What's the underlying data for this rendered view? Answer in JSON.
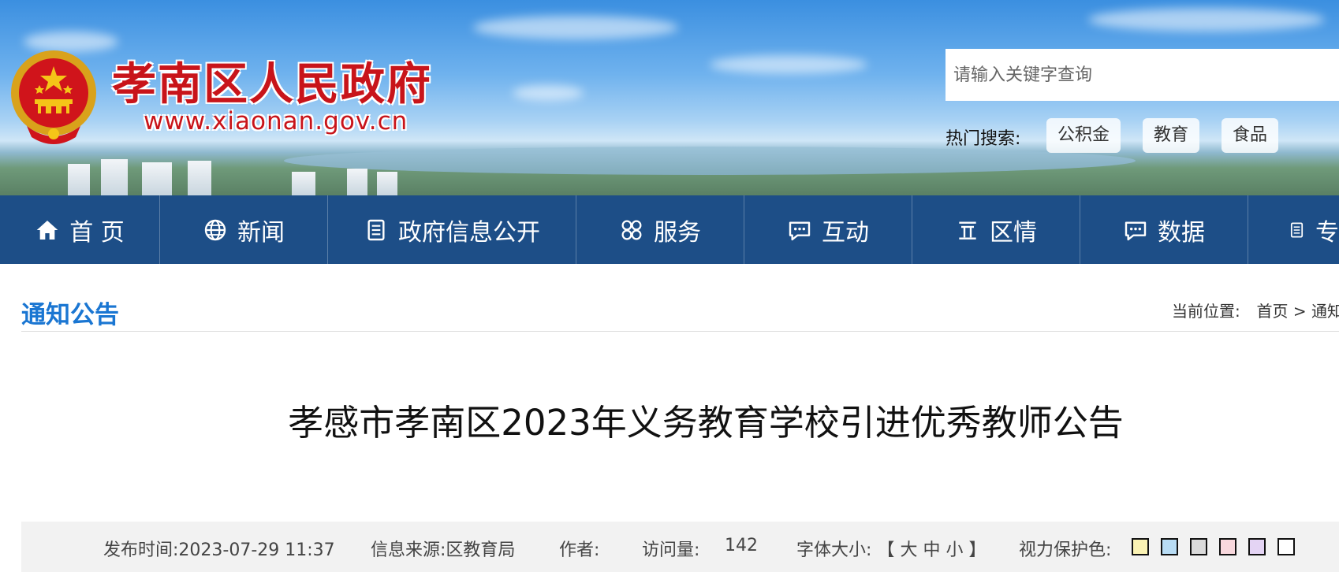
{
  "header": {
    "site_title": "孝南区人民政府",
    "site_url": "www.xiaonan.gov.cn",
    "emblem_icon": "national-emblem-icon",
    "brand_color": "#c8141a"
  },
  "search": {
    "placeholder": "请输入关键字查询",
    "hot_label": "热门搜索:",
    "hot_tags": [
      "公积金",
      "教育",
      "食品"
    ]
  },
  "nav": {
    "color": "#1d4e87",
    "items": [
      {
        "label": "首 页",
        "icon": "home-icon"
      },
      {
        "label": "新闻",
        "icon": "globe-icon"
      },
      {
        "label": "政府信息公开",
        "icon": "document-icon"
      },
      {
        "label": "服务",
        "icon": "grid-icon"
      },
      {
        "label": "互动",
        "icon": "chat-icon"
      },
      {
        "label": "区情",
        "icon": "monument-icon"
      },
      {
        "label": "数据",
        "icon": "chat-icon"
      },
      {
        "label": "专",
        "icon": "document-icon"
      }
    ]
  },
  "channel": {
    "title": "通知公告",
    "breadcrumb_label": "当前位置:",
    "breadcrumb_home": "首页",
    "breadcrumb_sep": ">",
    "breadcrumb_current": "通知",
    "accent": "#1a76d2"
  },
  "article": {
    "title": "孝感市孝南区2023年义务教育学校引进优秀教师公告",
    "publish_label": "发布时间:",
    "publish_time": "2023-07-29 11:37",
    "source_label": "信息来源:",
    "source": "区教育局",
    "author_label": "作者:",
    "views_label": "访问量:",
    "views": "142",
    "font_size_label": "字体大小:",
    "font_size_open": "【",
    "font_large": "大",
    "font_medium": "中",
    "font_small": "小",
    "font_size_close": "】",
    "eye_care_label": "视力保护色:",
    "eye_care_colors": [
      "#fbf3b4",
      "#b8dcf4",
      "#dadada",
      "#f8d8dd",
      "#e4d4f4",
      "#ffffff"
    ]
  }
}
